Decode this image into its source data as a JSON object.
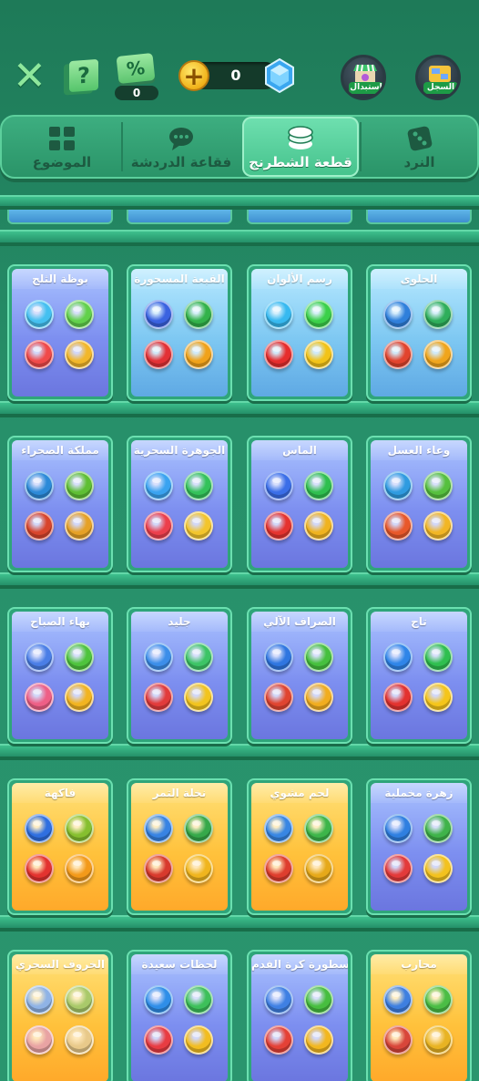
{
  "header": {
    "close_icon": "close-x-icon",
    "help_icon": "question-card-icon",
    "coupon_icon": "percent-coupon-icon",
    "coupon_count": "0",
    "coin_icon": "plus-coin-icon",
    "coin_count": "0",
    "gem_icon": "blue-gem-icon",
    "exchange_label": "استبدال",
    "record_label": "السجل"
  },
  "tabs": [
    {
      "label": "الموضوع",
      "icon": "grid-squares-icon",
      "selected": false
    },
    {
      "label": "فقاعة الدردشة",
      "icon": "chat-bubble-icon",
      "selected": false
    },
    {
      "label": "قطعة الشطرنج",
      "icon": "token-stack-icon",
      "selected": true
    },
    {
      "label": "النرد",
      "icon": "dice-icon",
      "selected": false
    }
  ],
  "colors": {
    "background": "#27906a",
    "tab_selected": "#45c28c",
    "card_blue": "#7d8ff0",
    "card_gold": "#ffc23c",
    "card_frame": "#6be0b0"
  },
  "rows": [
    {
      "cards": [
        {
          "title": "الحلوى",
          "bg": "cyan",
          "colors": [
            "#2fae5b",
            "#2f7fdb",
            "#f0a51c",
            "#e2442e"
          ]
        },
        {
          "title": "رسم الألوان",
          "bg": "cyan",
          "colors": [
            "#3bd04a",
            "#37b9f0",
            "#f2c318",
            "#e62d2d"
          ]
        },
        {
          "title": "القبعة المسحورة",
          "bg": "cyan",
          "colors": [
            "#33b24a",
            "#3a62e0",
            "#f0a21a",
            "#e33136"
          ]
        },
        {
          "title": "بوظة الثلج",
          "bg": "blue",
          "colors": [
            "#62d14b",
            "#44c0f0",
            "#f2b72a",
            "#f04a4a"
          ]
        }
      ]
    },
    {
      "cards": [
        {
          "title": "وعاء العسل",
          "bg": "blue",
          "colors": [
            "#56c03e",
            "#2f9be0",
            "#f2b624",
            "#e8582a"
          ]
        },
        {
          "title": "الماس",
          "bg": "blue",
          "colors": [
            "#2fbf4f",
            "#3a6ee8",
            "#f0b31f",
            "#e5332f"
          ]
        },
        {
          "title": "الجوهرة السحرية",
          "bg": "blue",
          "colors": [
            "#34c25a",
            "#3aa3f0",
            "#f3c52c",
            "#ec3f4c"
          ]
        },
        {
          "title": "مملكة الصحراء",
          "bg": "blue",
          "colors": [
            "#5fbf34",
            "#2c8ad8",
            "#e6a126",
            "#d8452c"
          ]
        }
      ]
    },
    {
      "cards": [
        {
          "title": "تاج",
          "bg": "blue",
          "colors": [
            "#2fbf4f",
            "#2f85e8",
            "#f5c51a",
            "#e3322f"
          ]
        },
        {
          "title": "الصراف الآلي",
          "bg": "blue",
          "colors": [
            "#46c03e",
            "#2f76e0",
            "#f1ad1f",
            "#e04430"
          ]
        },
        {
          "title": "جليد",
          "bg": "blue",
          "colors": [
            "#3dc466",
            "#3c8ee9",
            "#f2c41e",
            "#e23b3b"
          ]
        },
        {
          "title": "بهاء الصباح",
          "bg": "blue",
          "colors": [
            "#4ec43d",
            "#4a7ee6",
            "#f2b420",
            "#ee5f86"
          ]
        }
      ]
    },
    {
      "cards": [
        {
          "title": "زهرة مخملية",
          "bg": "blue",
          "colors": [
            "#3fb34a",
            "#2f7fe0",
            "#f3c21e",
            "#e33a3a"
          ]
        },
        {
          "title": "لحم مشوي",
          "bg": "gold",
          "colors": [
            "#3db54a",
            "#3886e3",
            "#e6a91a",
            "#de3e2e"
          ]
        },
        {
          "title": "نخلة التمر",
          "bg": "gold",
          "colors": [
            "#36a84a",
            "#3783e3",
            "#f0b51e",
            "#d83a2d"
          ]
        },
        {
          "title": "فاكهة",
          "bg": "gold",
          "colors": [
            "#86bf2f",
            "#2f6fe0",
            "#f39a1a",
            "#e3332f"
          ]
        }
      ]
    },
    {
      "cards": [
        {
          "title": "محارب",
          "bg": "gold",
          "colors": [
            "#4bbd45",
            "#3e7fe0",
            "#e8b323",
            "#d8463a"
          ]
        },
        {
          "title": "أسطورة كرة القدم",
          "bg": "blue",
          "colors": [
            "#47be3f",
            "#3f80e3",
            "#f2b71f",
            "#e44136"
          ]
        },
        {
          "title": "لحظات سعيدة",
          "bg": "blue",
          "colors": [
            "#3dc05a",
            "#2f8ee8",
            "#f2bd20",
            "#e83c42"
          ]
        },
        {
          "title": "الخروف السحري",
          "bg": "gold",
          "colors": [
            "#a9c96a",
            "#8fb3e6",
            "#e8c98a",
            "#e8a3a3"
          ]
        }
      ]
    }
  ]
}
